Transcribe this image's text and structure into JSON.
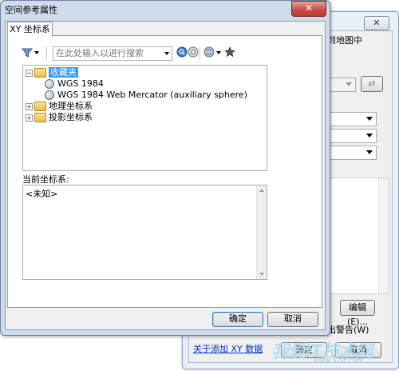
{
  "background_window": {
    "close_label": "✕",
    "text_map": "到地图中",
    "edit_button": "编辑(E)...",
    "warn_text": "出警告(W)",
    "help_link": "关于添加 XY 数据",
    "ok_button": "确定",
    "cancel_button": "取消"
  },
  "dialog": {
    "title": "空间参考属性",
    "close_label": "✕",
    "tab_label": "XY 坐标系",
    "search_placeholder": "在此处输入以进行搜索",
    "tree": [
      {
        "label": "收藏夹",
        "expanded": true,
        "selected": true
      },
      {
        "label": "WGS 1984"
      },
      {
        "label": "WGS 1984 Web Mercator (auxiliary sphere)"
      },
      {
        "label": "地理坐标系",
        "expanded": false
      },
      {
        "label": "投影坐标系",
        "expanded": false
      }
    ],
    "current_label": "当前坐标系:",
    "current_value": "<未知>",
    "ok_button": "确定",
    "cancel_button": "取消"
  },
  "icons": [
    "filter-icon",
    "search-icon",
    "globe-search-icon",
    "globe-icon",
    "favorite-add-icon"
  ],
  "watermark": {
    "main": "我爱IT技术网",
    "sub": "www.52it.com"
  },
  "colors": {
    "selection": "#3399ff",
    "close_button": "#c75050",
    "dialog_frame": "#cfdbe9"
  }
}
